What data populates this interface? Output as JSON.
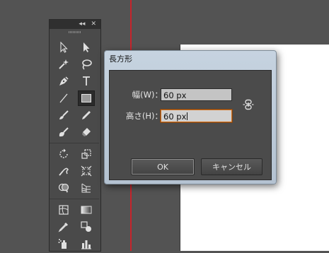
{
  "tools_panel": {
    "collapse_glyph": "◂◂",
    "close_glyph": "✕",
    "tools": [
      {
        "name": "selection-tool-icon"
      },
      {
        "name": "direct-selection-tool-icon"
      },
      {
        "name": "magic-wand-tool-icon"
      },
      {
        "name": "lasso-tool-icon"
      },
      {
        "name": "pen-tool-icon"
      },
      {
        "name": "type-tool-icon",
        "glyph": "T"
      },
      {
        "name": "line-segment-tool-icon"
      },
      {
        "name": "rectangle-tool-icon",
        "active": true
      },
      {
        "name": "paintbrush-tool-icon"
      },
      {
        "name": "pencil-tool-icon"
      },
      {
        "name": "blob-brush-tool-icon"
      },
      {
        "name": "eraser-tool-icon"
      },
      {
        "name": "rotate-tool-icon"
      },
      {
        "name": "scale-tool-icon"
      },
      {
        "name": "warp-tool-icon"
      },
      {
        "name": "free-transform-tool-icon"
      },
      {
        "name": "shape-builder-tool-icon"
      },
      {
        "name": "perspective-grid-tool-icon"
      },
      {
        "name": "mesh-tool-icon"
      },
      {
        "name": "gradient-tool-icon"
      },
      {
        "name": "eyedropper-tool-icon"
      },
      {
        "name": "blend-tool-icon"
      },
      {
        "name": "symbol-sprayer-tool-icon"
      },
      {
        "name": "column-graph-tool-icon"
      }
    ]
  },
  "dialog": {
    "title": "長方形",
    "width_label": "幅(W)：",
    "width_value": "60 px",
    "height_label": "高さ(H)：",
    "height_value": "60 px",
    "ok_label": "OK",
    "cancel_label": "キャンセル"
  },
  "colors": {
    "canvas_bg": "#535353",
    "guide": "#c8242b",
    "focus_ring": "#d2701e"
  }
}
